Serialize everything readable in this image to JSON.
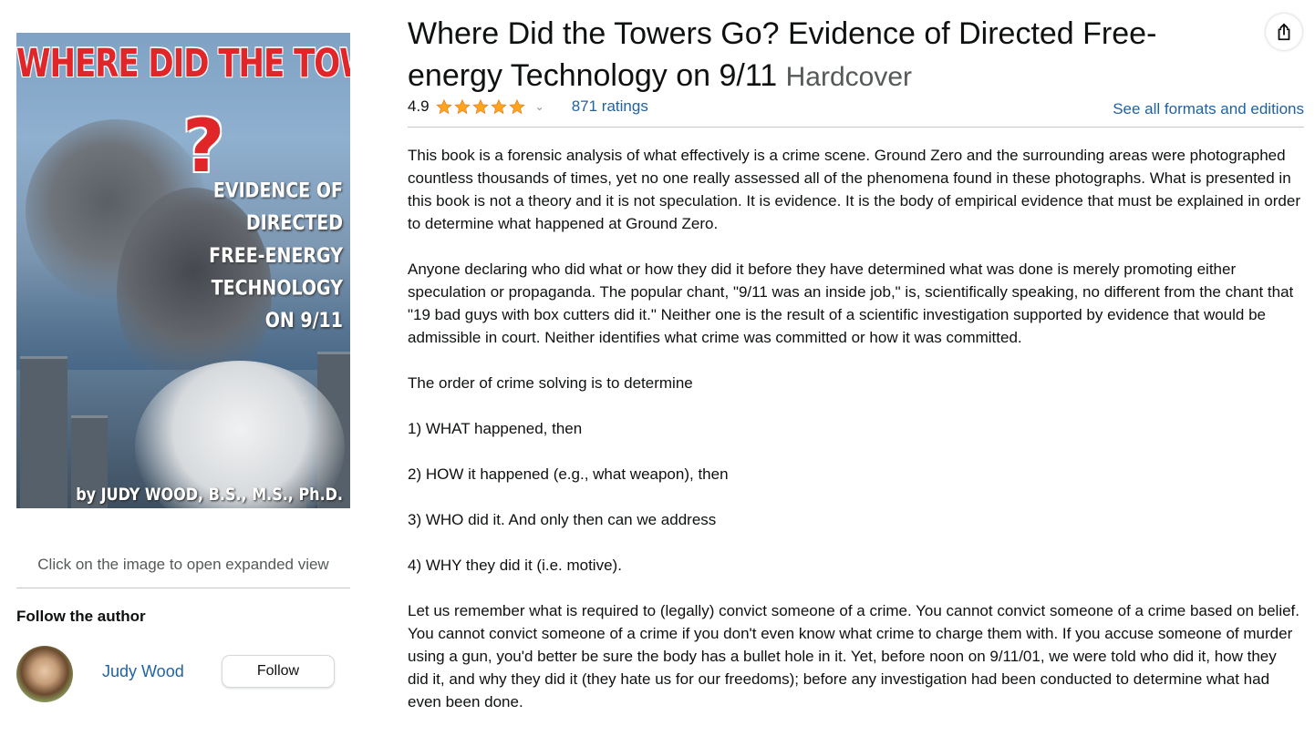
{
  "cover": {
    "title": "WHERE DID THE TOWERS GO",
    "question_mark": "?",
    "subtitle_lines": [
      "EVIDENCE OF DIRECTED",
      "FREE-ENERGY",
      "TECHNOLOGY",
      "ON 9/11"
    ],
    "author": "by JUDY WOOD, B.S., M.S., Ph.D.",
    "accent_color": "#e1262a"
  },
  "left": {
    "expand_hint": "Click on the image to open expanded view",
    "follow_heading": "Follow the author",
    "author_name": "Judy Wood",
    "follow_button": "Follow"
  },
  "product": {
    "title": "Where Did the Towers Go? Evidence of Directed Free-energy Technology on 9/11",
    "format": "Hardcover",
    "rating": "4.9",
    "stars_filled": 5,
    "ratings_count": "871 ratings",
    "formats_link": "See all formats and editions",
    "share_icon": "share-icon",
    "link_color": "#2162a1",
    "star_color": "#ffa41c"
  },
  "description": [
    "This book is a forensic analysis of what effectively is a crime scene. Ground Zero and the surrounding areas were photographed countless thousands of times, yet no one really assessed all of the phenomena found in these photographs. What is presented in this book is not a theory and it is not speculation. It is evidence. It is the body of empirical evidence that must be explained in order to determine what happened at Ground Zero.",
    "Anyone declaring who did what or how they did it before they have determined what was done is merely promoting either speculation or propaganda. The popular chant, \"9/11 was an inside job,\" is, scientifically speaking, no different from the chant that \"19 bad guys with box cutters did it.\" Neither one is the result of a scientific investigation supported by evidence that would be admissible in court. Neither identifies what crime was committed or how it was committed.",
    "The order of crime solving is to determine",
    "1) WHAT happened, then",
    "2) HOW it happened (e.g., what weapon), then",
    "3) WHO did it. And only then can we address",
    "4) WHY they did it (i.e. motive).",
    "Let us remember what is required to (legally) convict someone of a crime. You cannot convict someone of a crime based on belief. You cannot convict someone of a crime if you don't even know what crime to charge them with. If you accuse someone of murder using a gun, you'd better be sure the body has a bullet hole in it. Yet, before noon on 9/11/01, we were told who did it, how they did it, and why they did it (they hate us for our freedoms); before any investigation had been conducted to determine what had even been done."
  ]
}
